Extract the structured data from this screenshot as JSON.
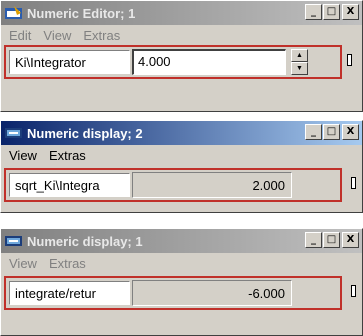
{
  "windows": [
    {
      "id": "numeric-editor-1",
      "title": "Numeric Editor; 1",
      "active": false,
      "icon": "numeric-editor-icon",
      "menu": [
        "Edit",
        "View",
        "Extras"
      ],
      "label": "Ki\\Integrator",
      "value": "4.000",
      "editable": true
    },
    {
      "id": "numeric-display-2",
      "title": "Numeric display; 2",
      "active": true,
      "icon": "numeric-display-icon",
      "menu": [
        "View",
        "Extras"
      ],
      "label": "sqrt_Ki\\Integra",
      "value": "2.000",
      "editable": false
    },
    {
      "id": "numeric-display-1",
      "title": "Numeric display; 1",
      "active": false,
      "icon": "numeric-display-icon",
      "menu": [
        "View",
        "Extras"
      ],
      "label": "integrate/retur",
      "value": "-6.000",
      "editable": false
    }
  ],
  "titlebar_buttons": {
    "minimize": "_",
    "maximize": "□",
    "close": "X"
  },
  "colors": {
    "active_title_start": "#0a246a",
    "active_title_end": "#a6caf0",
    "inactive_title_start": "#808080",
    "inactive_title_end": "#c0c0c0",
    "row_border": "#c0302a",
    "window_face": "#d4d0c8"
  }
}
